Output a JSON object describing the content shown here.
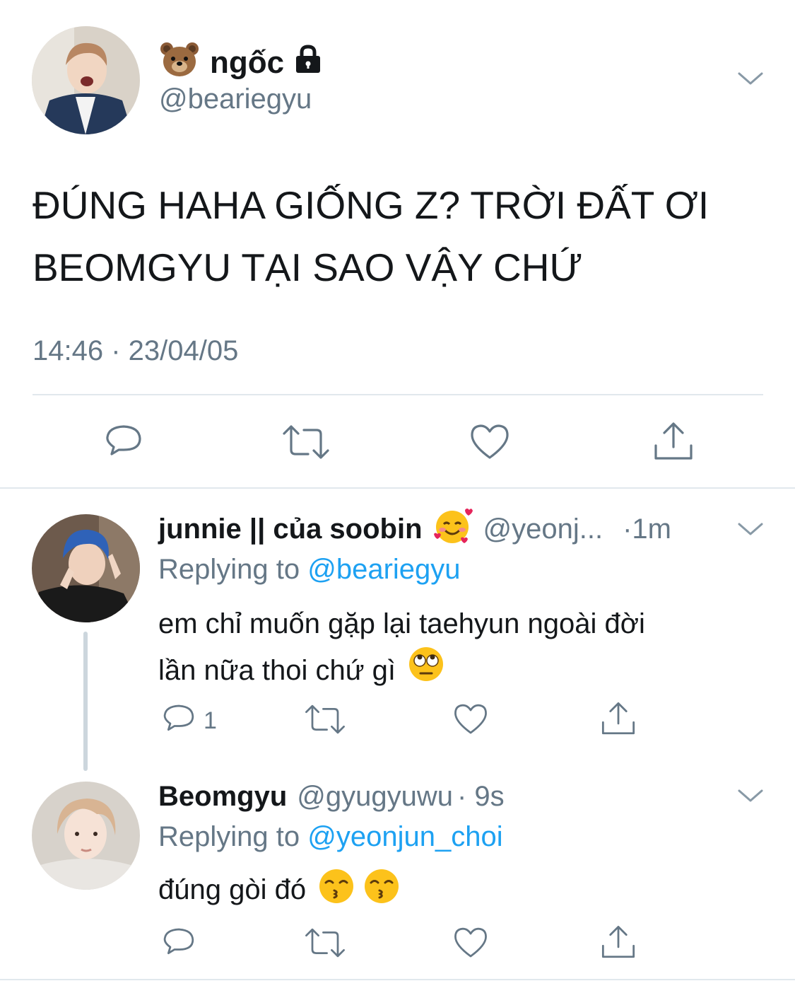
{
  "main_tweet": {
    "display_name": "ngốc",
    "name_emoji": "bear-face-emoji",
    "badge_icon": "lock-icon",
    "handle": "@beariegyu",
    "text_line1": "ĐÚNG HAHA GIỐNG Z? TRỜI ĐẤT ƠI",
    "text_line2": "BEOMGYU TẠI SAO VẬY CHỨ",
    "timestamp": "14:46 · 23/04/05",
    "actions": [
      "reply-icon",
      "retweet-icon",
      "like-icon",
      "share-icon"
    ]
  },
  "replies": [
    {
      "display_name": "junnie || của soobin",
      "name_emoji": "smiling-face-with-hearts-emoji",
      "handle": "@yeonj...",
      "time": "·1m",
      "replying_label": "Replying to",
      "replying_handle": "@beariegyu",
      "text_line1": "em chỉ muốn gặp lại taehyun ngoài đời",
      "text_line2": "lần nữa thoi chứ gì",
      "text_emoji": "face-with-rolling-eyes-emoji",
      "reply_count": "1"
    },
    {
      "display_name": "Beomgyu",
      "handle": "@gyugyuwu",
      "time": "· 9s",
      "replying_label": "Replying to",
      "replying_handle": "@yeonjun_choi",
      "text_line1": "đúng gòi đó",
      "text_emoji": "kissing-face-with-smiling-eyes-emoji"
    }
  ],
  "colors": {
    "text": "#14171a",
    "muted": "#657786",
    "link": "#1da1f2",
    "divider": "#e1e8ed"
  }
}
